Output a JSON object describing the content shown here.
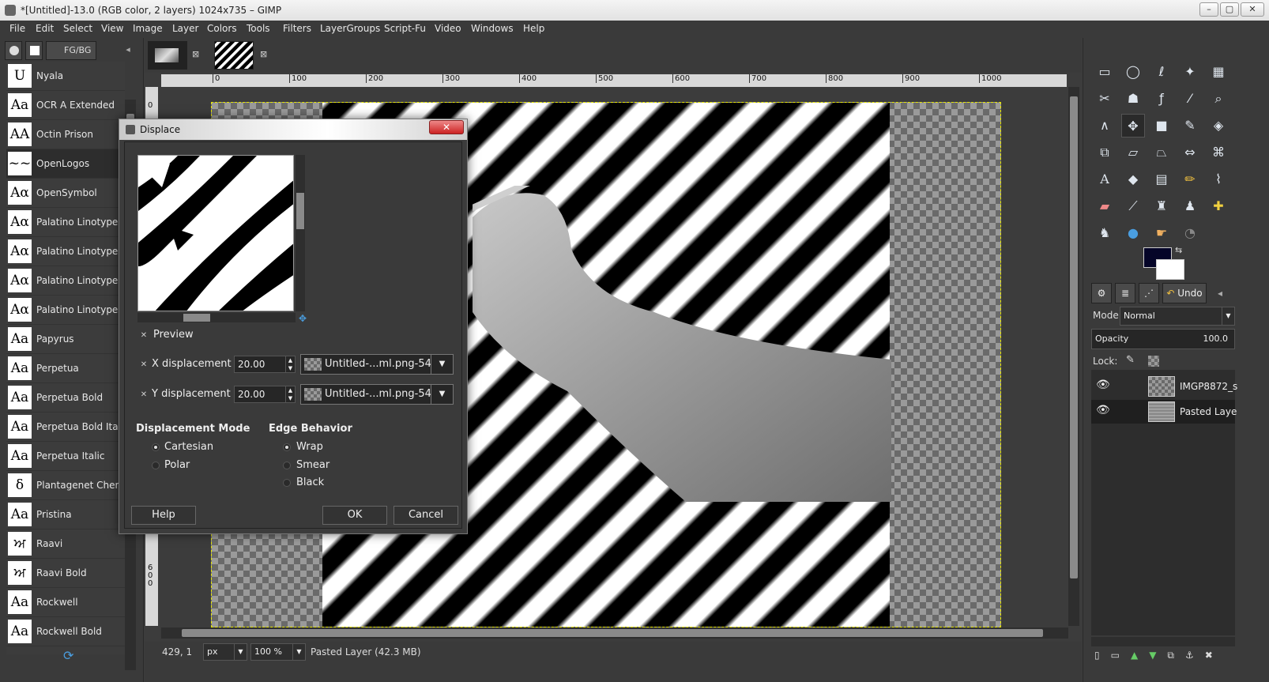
{
  "window": {
    "title": "*[Untitled]-13.0 (RGB color, 2 layers) 1024x735 – GIMP",
    "min": "–",
    "max": "▢",
    "close": "✕"
  },
  "menu": [
    "File",
    "Edit",
    "Select",
    "View",
    "Image",
    "Layer",
    "Colors",
    "Tools",
    "Filters",
    "LayerGroups",
    "Script-Fu",
    "Video",
    "Windows",
    "Help"
  ],
  "left_dock": {
    "tab_label": "FG/BG",
    "fonts": [
      {
        "thumb": "U",
        "name": "Nyala"
      },
      {
        "thumb": "Aa",
        "name": "OCR A Extended"
      },
      {
        "thumb": "AA",
        "name": "Octin Prison"
      },
      {
        "thumb": "~~",
        "name": "OpenLogos"
      },
      {
        "thumb": "Aα",
        "name": "OpenSymbol"
      },
      {
        "thumb": "Aα",
        "name": "Palatino Linotype"
      },
      {
        "thumb": "Aα",
        "name": "Palatino Linotype B"
      },
      {
        "thumb": "Aα",
        "name": "Palatino Linotype B"
      },
      {
        "thumb": "Aα",
        "name": "Palatino Linotype It"
      },
      {
        "thumb": "Aa",
        "name": "Papyrus"
      },
      {
        "thumb": "Aa",
        "name": "Perpetua"
      },
      {
        "thumb": "Aa",
        "name": "Perpetua Bold"
      },
      {
        "thumb": "Aa",
        "name": "Perpetua Bold Italic"
      },
      {
        "thumb": "Aa",
        "name": "Perpetua Italic"
      },
      {
        "thumb": "δ",
        "name": "Plantagenet Chero"
      },
      {
        "thumb": "Aa",
        "name": "Pristina"
      },
      {
        "thumb": "ਅ",
        "name": "Raavi"
      },
      {
        "thumb": "ਅ",
        "name": "Raavi Bold"
      },
      {
        "thumb": "Aa",
        "name": "Rockwell"
      },
      {
        "thumb": "Aa",
        "name": "Rockwell Bold"
      }
    ],
    "selected_index": 3
  },
  "ruler": {
    "h_ticks": [
      "0",
      "100",
      "200",
      "300",
      "400",
      "500",
      "600",
      "700",
      "800",
      "900",
      "1000"
    ],
    "v_ticks": [
      "0",
      "6\n0\n0"
    ]
  },
  "status": {
    "coords": "429, 1",
    "unit": "px",
    "zoom": "100 %",
    "layer_info": "Pasted Layer (42.3 MB)"
  },
  "right_dock": {
    "tab_undo": "Undo",
    "mode_label": "Mode:",
    "mode_value": "Normal",
    "opacity_label": "Opacity",
    "opacity_value": "100.0",
    "lock_label": "Lock:",
    "layers": [
      {
        "name": "IMGP8872_s",
        "visible": true
      },
      {
        "name": "Pasted Laye",
        "visible": true
      }
    ],
    "fg_color": "#050528",
    "bg_color": "#ffffff"
  },
  "dialog": {
    "title": "Displace",
    "preview_label": "Preview",
    "x_label": "X displacement",
    "x_value": "20.00",
    "x_map": "Untitled-...ml.png-54",
    "y_label": "Y displacement",
    "y_value": "20.00",
    "y_map": "Untitled-...ml.png-54",
    "mode_heading": "Displacement Mode",
    "mode_options": [
      "Cartesian",
      "Polar"
    ],
    "mode_selected": "Cartesian",
    "edge_heading": "Edge Behavior",
    "edge_options": [
      "Wrap",
      "Smear",
      "Black"
    ],
    "edge_selected": "Wrap",
    "help": "Help",
    "ok": "OK",
    "cancel": "Cancel"
  }
}
